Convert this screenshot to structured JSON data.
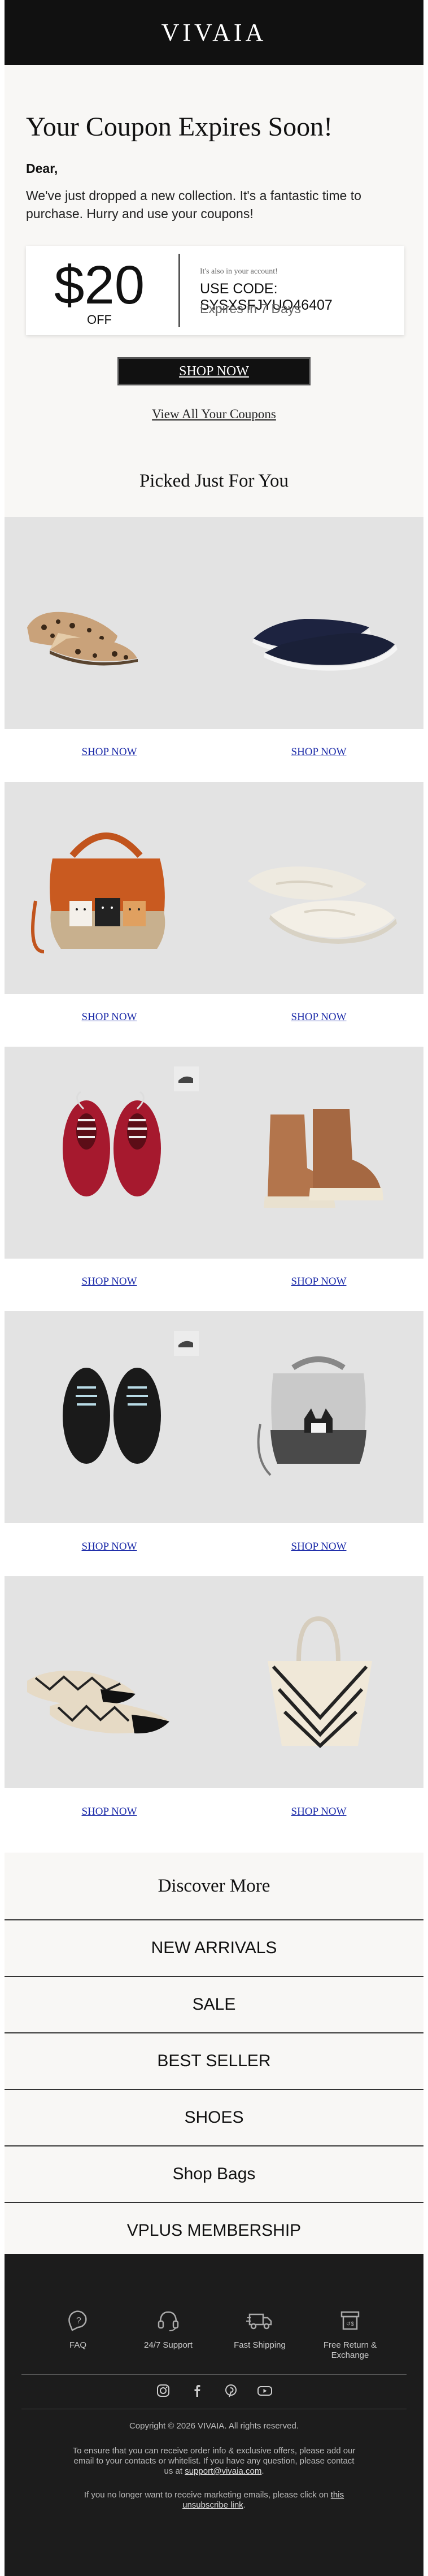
{
  "brand": "VIVAIA",
  "hero": {
    "title": "Your Coupon Expires Soon!",
    "greeting": "Dear,",
    "intro": "We've just dropped a new collection. It's a fantastic time to purchase. Hurry and use your coupons!"
  },
  "coupon": {
    "amount": "$20",
    "off_label": "OFF",
    "note": "It's also in your account!",
    "code": "USE CODE: SYSXSFJYUO46407",
    "expiry": "Expires in 7 Days"
  },
  "cta": {
    "shop_now": "SHOP NOW",
    "view_all": "View All Your Coupons"
  },
  "picked": {
    "title": "Picked Just For You"
  },
  "products": {
    "link_label": "SHOP NOW",
    "rows": [
      {
        "left": "leopard-flats",
        "right": "navy-slip-on-flats"
      },
      {
        "left": "cat-print-tote-bag",
        "right": "white-lace-up-flats"
      },
      {
        "left": "red-knit-sneakers",
        "right": "tan-ankle-boots"
      },
      {
        "left": "black-knit-sneakers",
        "right": "grey-cat-handbag"
      },
      {
        "left": "chevron-ballet-flats",
        "right": "chevron-bucket-bag"
      }
    ]
  },
  "discover": {
    "title": "Discover More",
    "items": [
      "NEW ARRIVALS",
      "SALE",
      "BEST SELLER",
      "SHOES",
      "Shop Bags",
      "VPLUS MEMBERSHIP"
    ]
  },
  "footer": {
    "features": [
      {
        "icon": "faq-icon",
        "label": "FAQ"
      },
      {
        "icon": "headset-icon",
        "label": "24/7 Support"
      },
      {
        "icon": "truck-icon",
        "label": "Fast Shipping"
      },
      {
        "icon": "return-box-icon",
        "label": "Free Return & Exchange"
      }
    ],
    "socials": [
      "instagram-icon",
      "facebook-icon",
      "pinterest-icon",
      "youtube-icon"
    ],
    "copyright": "Copyright © 2026 VIVAIA. All rights reserved.",
    "legal_text": "To ensure that you can receive order info & exclusive offers, please add our email to your contacts or whitelist. If you have any question, please contact us at",
    "support_email": "support@vivaia.com",
    "unsub_text": "If you no longer want to receive marketing emails, please click on",
    "unsub_link": "this unsubscribe link"
  },
  "colors": {
    "header": "#111111",
    "hero_bg": "#f8f7f5",
    "product_bg": "#e3e3e3",
    "link": "#1b2aa8",
    "footer": "#1c1c1c"
  }
}
